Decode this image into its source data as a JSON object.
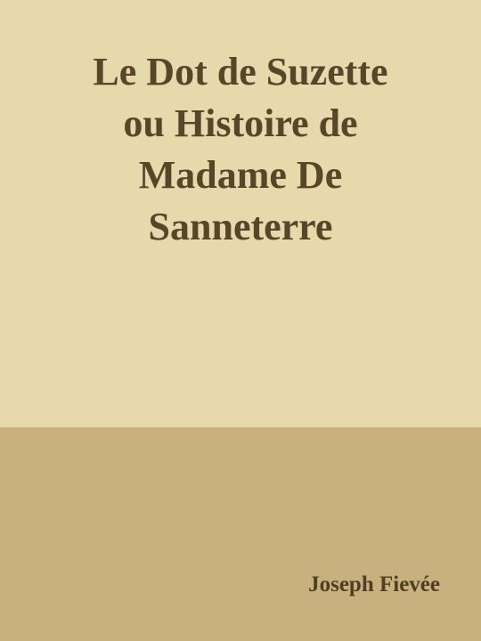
{
  "cover": {
    "title_lines": [
      "Le Dot de Suzette",
      "ou Histoire de",
      "Madame De",
      "Sanneterre"
    ],
    "author": "Joseph Fievée"
  },
  "colors": {
    "top_background": "#e6d9ab",
    "bottom_background": "#c8b07f",
    "title_text": "#574628",
    "author_text": "#4f3f22"
  }
}
